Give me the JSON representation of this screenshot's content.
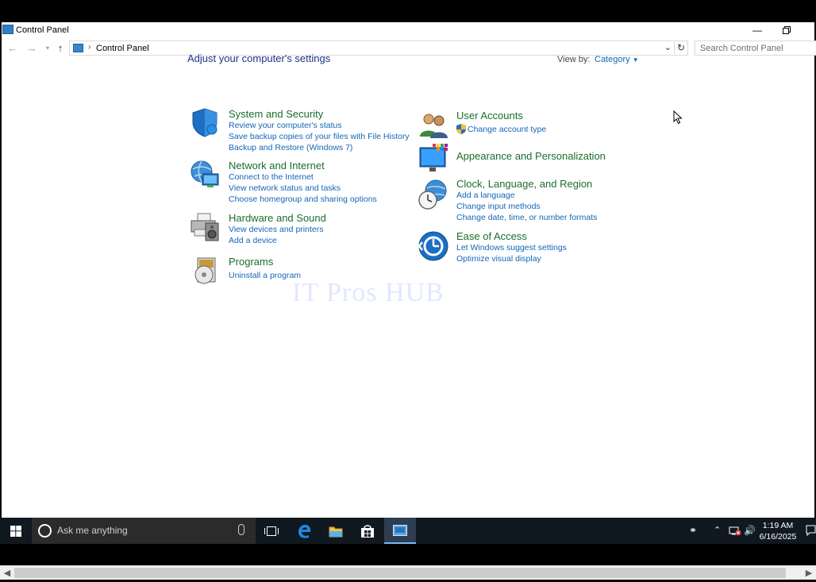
{
  "window": {
    "title": "Control Panel"
  },
  "address": {
    "path": "Control Panel",
    "search_placeholder": "Search Control Panel"
  },
  "main": {
    "heading": "Adjust your computer's settings",
    "view_by_label": "View by:",
    "view_by_value": "Category"
  },
  "categories_left": [
    {
      "title": "System and Security",
      "links": [
        "Review your computer's status",
        "Save backup copies of your files with File History",
        "Backup and Restore (Windows 7)"
      ]
    },
    {
      "title": "Network and Internet",
      "links": [
        "Connect to the Internet",
        "View network status and tasks",
        "Choose homegroup and sharing options"
      ]
    },
    {
      "title": "Hardware and Sound",
      "links": [
        "View devices and printers",
        "Add a device"
      ]
    },
    {
      "title": "Programs",
      "links": [
        "Uninstall a program"
      ]
    }
  ],
  "categories_right": [
    {
      "title": "User Accounts",
      "links": [
        "Change account type"
      ]
    },
    {
      "title": "Appearance and Personalization",
      "links": []
    },
    {
      "title": "Clock, Language, and Region",
      "links": [
        "Add a language",
        "Change input methods",
        "Change date, time, or number formats"
      ]
    },
    {
      "title": "Ease of Access",
      "links": [
        "Let Windows suggest settings",
        "Optimize visual display"
      ]
    }
  ],
  "watermark": "IT Pros HUB",
  "taskbar": {
    "search_placeholder": "Ask me anything",
    "time": "1:19 AM",
    "date": "6/16/2025"
  },
  "colors": {
    "title_green": "#1a6e2c",
    "link_blue": "#1565b8",
    "heading_blue": "#1e3287",
    "taskbar": "#101820"
  }
}
